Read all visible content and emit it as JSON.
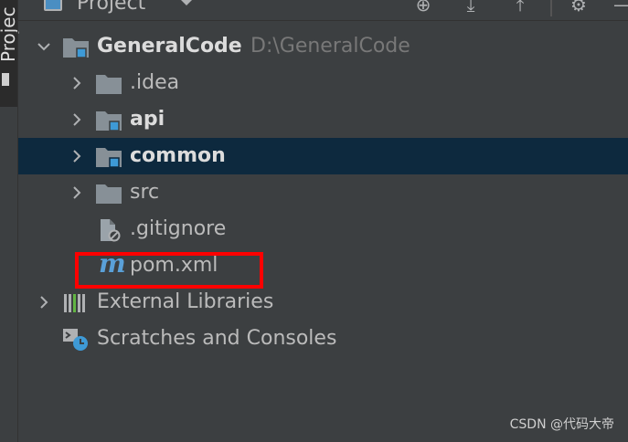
{
  "panel": {
    "side_tab": "Project",
    "toolbar_title": "Project"
  },
  "tree": {
    "root": {
      "name": "GeneralCode",
      "path": "D:\\GeneralCode"
    },
    "idea": ".idea",
    "api": "api",
    "common": "common",
    "src": "src",
    "gitignore": ".gitignore",
    "pom": "pom.xml",
    "pom_icon_glyph": "m",
    "external_libraries": "External Libraries",
    "scratches": "Scratches and Consoles"
  },
  "watermark": "CSDN @代码大帝",
  "colors": {
    "background": "#3c3f41",
    "selection": "#0d293e",
    "folder": "#879097",
    "module_badge": "#3e9ad6",
    "highlight_box": "#ff0000",
    "maven_icon": "#5aa0d8"
  }
}
